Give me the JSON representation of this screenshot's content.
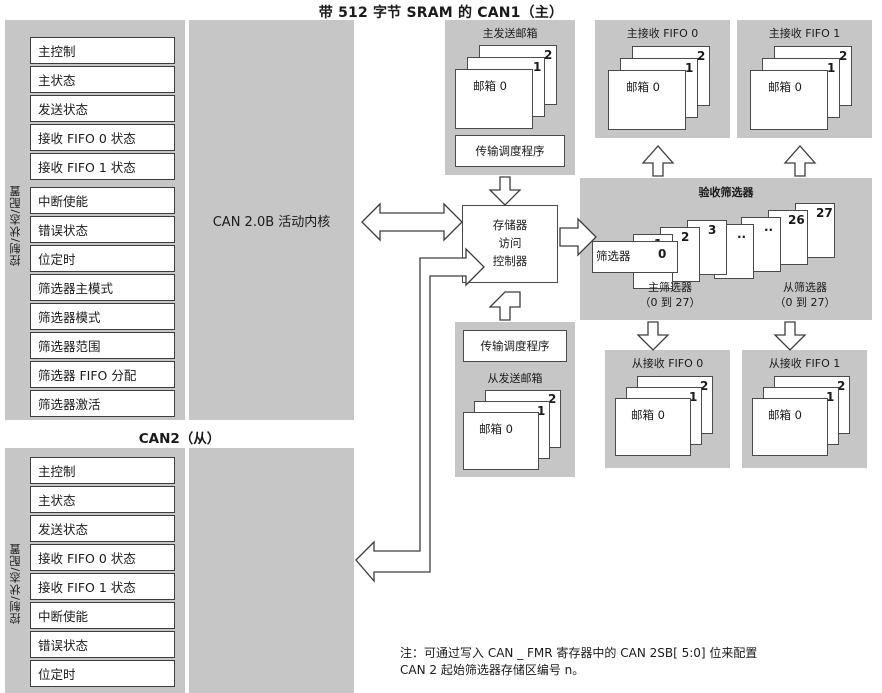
{
  "title": "带 512 字节 SRAM 的 CAN1（主）",
  "can1": {
    "side_label": "控制/状态/配置",
    "registers": [
      "主控制",
      "主状态",
      "发送状态",
      "接收 FIFO 0 状态",
      "接收 FIFO 1 状态",
      "中断使能",
      "错误状态",
      "位定时",
      "筛选器主模式",
      "筛选器模式",
      "筛选器范围",
      "筛选器 FIFO 分配",
      "筛选器激活"
    ],
    "core_label": "CAN 2.0B 活动内核"
  },
  "can2": {
    "title": "CAN2（从）",
    "side_label": "控制/状态/配置",
    "registers": [
      "主控制",
      "主状态",
      "发送状态",
      "接收 FIFO 0 状态",
      "接收 FIFO 1 状态",
      "中断使能",
      "错误状态",
      "位定时"
    ]
  },
  "master_tx": {
    "title": "主发送邮箱",
    "mailbox_labels": [
      "邮箱 0",
      "1",
      "2"
    ],
    "scheduler": "传输调度程序"
  },
  "slave_tx": {
    "title": "从发送邮箱",
    "mailbox_labels": [
      "邮箱 0",
      "1",
      "2"
    ],
    "scheduler": "传输调度程序"
  },
  "memory_controller": {
    "line1": "存储器",
    "line2": "访问",
    "line3": "控制器"
  },
  "master_rx_fifo0": {
    "title": "主接收 FIFO 0",
    "mailbox_labels": [
      "邮箱 0",
      "1",
      "2"
    ]
  },
  "master_rx_fifo1": {
    "title": "主接收 FIFO 1",
    "mailbox_labels": [
      "邮箱 0",
      "1",
      "2"
    ]
  },
  "slave_rx_fifo0": {
    "title": "从接收 FIFO 0",
    "mailbox_labels": [
      "邮箱 0",
      "1",
      "2"
    ]
  },
  "slave_rx_fifo1": {
    "title": "从接收 FIFO 1",
    "mailbox_labels": [
      "邮箱 0",
      "1",
      "2"
    ]
  },
  "filters": {
    "title": "验收筛选器",
    "first_label": "筛选器",
    "numbers": [
      "0",
      "1",
      "2",
      "3",
      "..",
      "..",
      "26",
      "27"
    ],
    "master_caption_line1": "主筛选器",
    "master_caption_line2": "（0 到 27）",
    "slave_caption_line1": "从筛选器",
    "slave_caption_line2": "（0 到 27）"
  },
  "note": "注：可通过写入 CAN _ FMR 寄存器中的 CAN 2SB[ 5:0] 位来配置\n        CAN 2 起始筛选器存储区编号 n。",
  "colors": {
    "panel_gray": "#c6c6c6",
    "box_white": "#ffffff",
    "stroke": "#3d3d3d",
    "text": "#1a1a1a"
  }
}
